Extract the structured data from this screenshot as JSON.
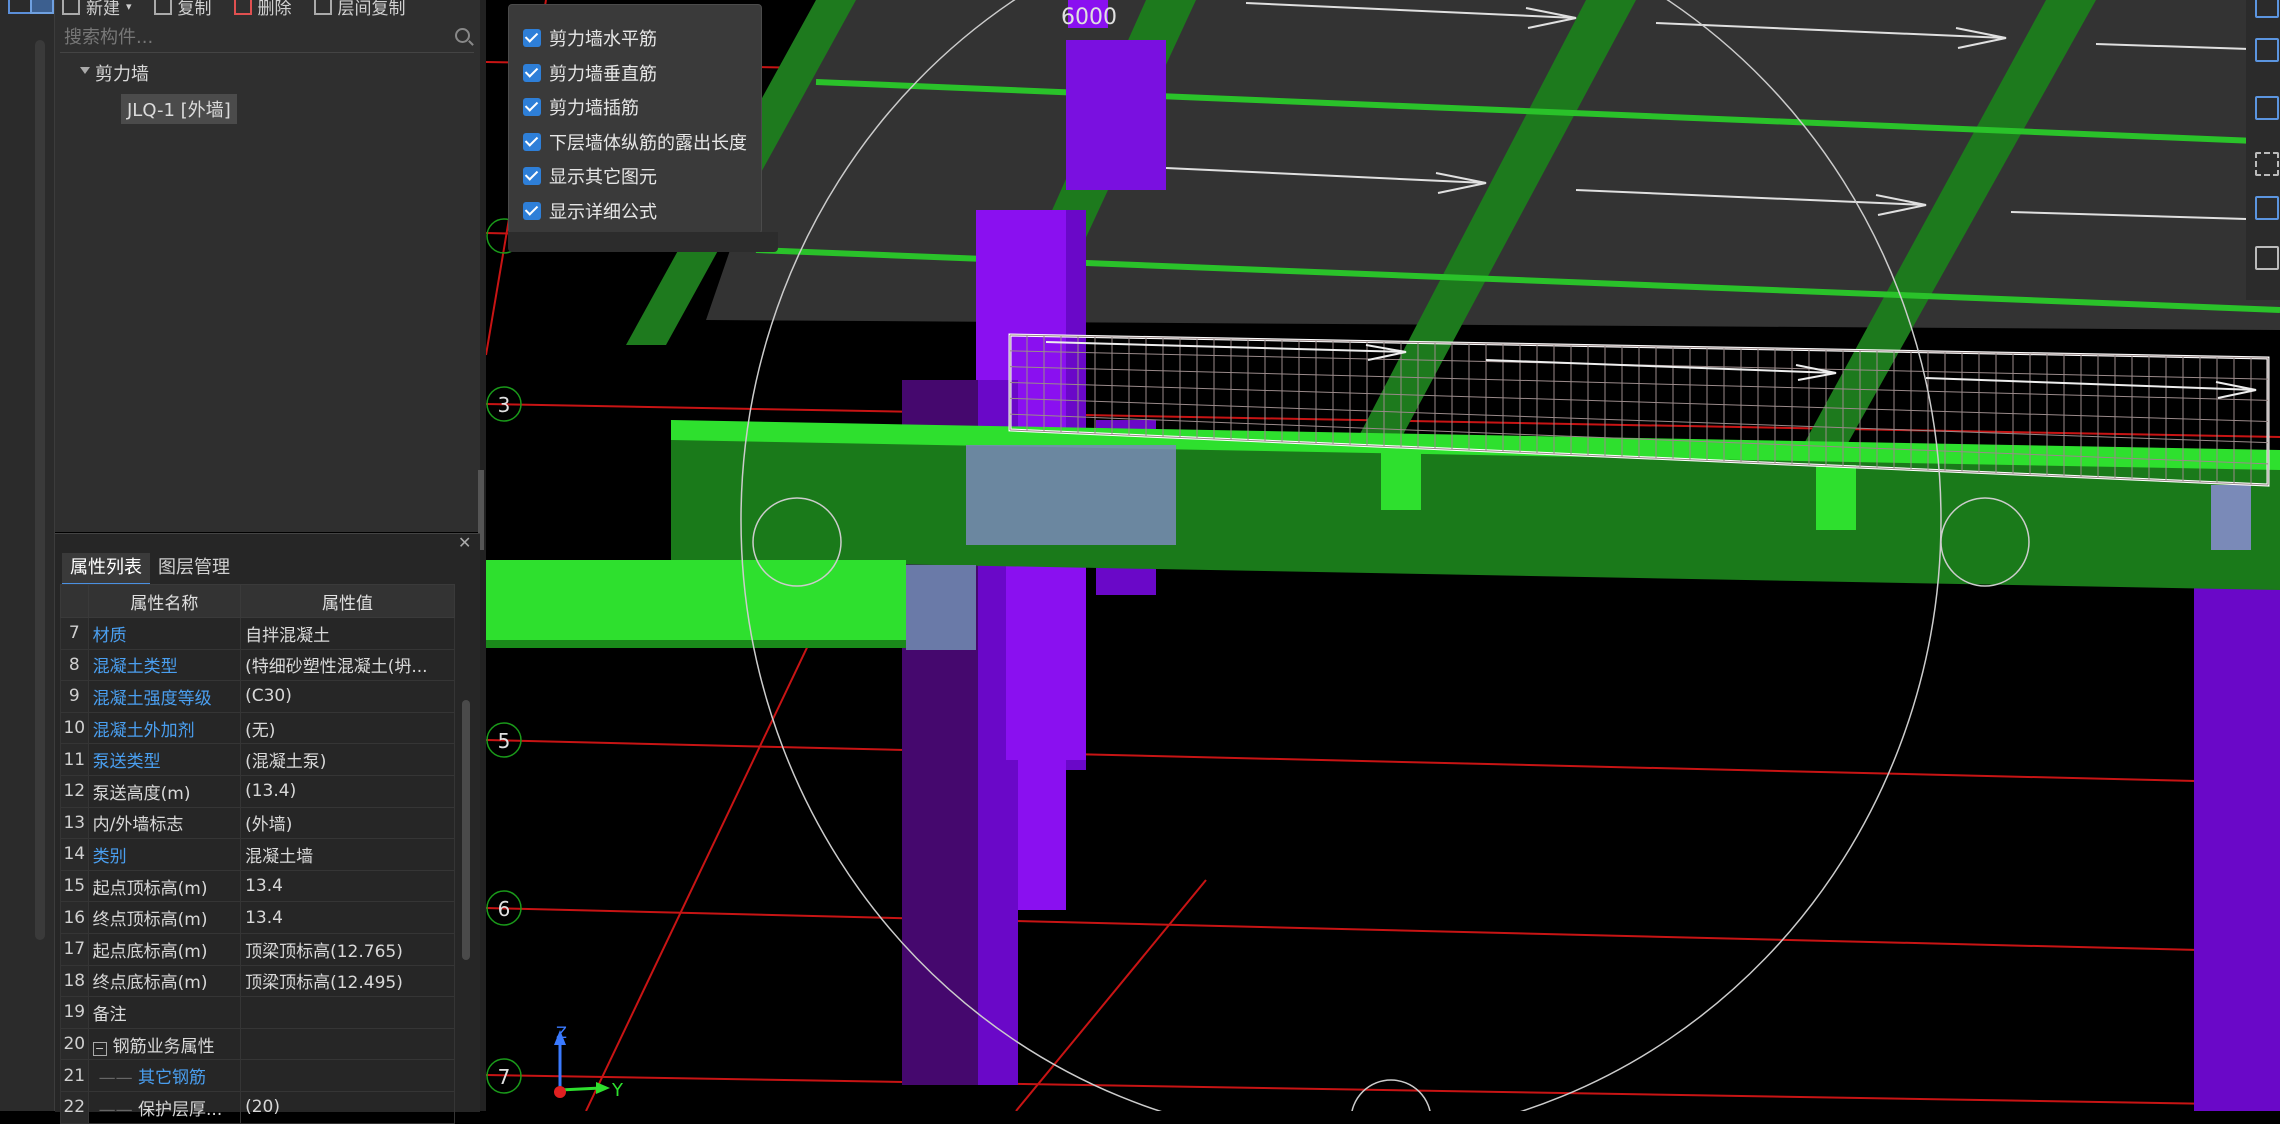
{
  "toolbar": {
    "new_label": "新建",
    "copy_label": "复制",
    "delete_label": "删除",
    "floor_copy_label": "层间复制"
  },
  "component_panel": {
    "search_placeholder": "搜索构件...",
    "tree_root": "剪力墙",
    "tree_child": "JLQ-1 [外墙]"
  },
  "properties": {
    "tabs": [
      "属性列表",
      "图层管理"
    ],
    "headers": [
      "属性名称",
      "属性值"
    ],
    "rows": [
      {
        "num": "7",
        "name": "材质",
        "value": "自拌混凝土",
        "blue": true
      },
      {
        "num": "8",
        "name": "混凝土类型",
        "value": "(特细砂塑性混凝土(坍...",
        "blue": true
      },
      {
        "num": "9",
        "name": "混凝土强度等级",
        "value": "(C30)",
        "blue": true
      },
      {
        "num": "10",
        "name": "混凝土外加剂",
        "value": "(无)",
        "blue": true
      },
      {
        "num": "11",
        "name": "泵送类型",
        "value": "(混凝土泵)",
        "blue": true
      },
      {
        "num": "12",
        "name": "泵送高度(m)",
        "value": "(13.4)",
        "blue": false
      },
      {
        "num": "13",
        "name": "内/外墙标志",
        "value": "(外墙)",
        "blue": false
      },
      {
        "num": "14",
        "name": "类别",
        "value": "混凝土墙",
        "blue": true
      },
      {
        "num": "15",
        "name": "起点顶标高(m)",
        "value": "13.4",
        "blue": false
      },
      {
        "num": "16",
        "name": "终点顶标高(m)",
        "value": "13.4",
        "blue": false
      },
      {
        "num": "17",
        "name": "起点底标高(m)",
        "value": "顶梁顶标高(12.765)",
        "blue": false
      },
      {
        "num": "18",
        "name": "终点底标高(m)",
        "value": "顶梁顶标高(12.495)",
        "blue": false
      },
      {
        "num": "19",
        "name": "备注",
        "value": "",
        "blue": false
      },
      {
        "num": "20",
        "name": "钢筋业务属性",
        "value": "",
        "blue": false,
        "group": true
      },
      {
        "num": "21",
        "name": "其它钢筋",
        "value": "",
        "blue": true,
        "child": true
      },
      {
        "num": "22",
        "name": "保护层厚...",
        "value": "(20)",
        "blue": false,
        "child": true
      }
    ]
  },
  "display_options": [
    "剪力墙水平筋",
    "剪力墙垂直筋",
    "剪力墙插筋",
    "下层墙体纵筋的露出长度",
    "显示其它图元",
    "显示详细公式"
  ],
  "viewport": {
    "dimension_label": "6000",
    "axis_labels": [
      "3",
      "5",
      "6",
      "7"
    ],
    "coord_z": "Z",
    "coord_y": "Y",
    "colors": {
      "column": "#8a10f0",
      "beam": "#1d7a1d",
      "beam_light": "#2ee02e",
      "grid_line": "#c81414",
      "slab": "#333333"
    }
  }
}
